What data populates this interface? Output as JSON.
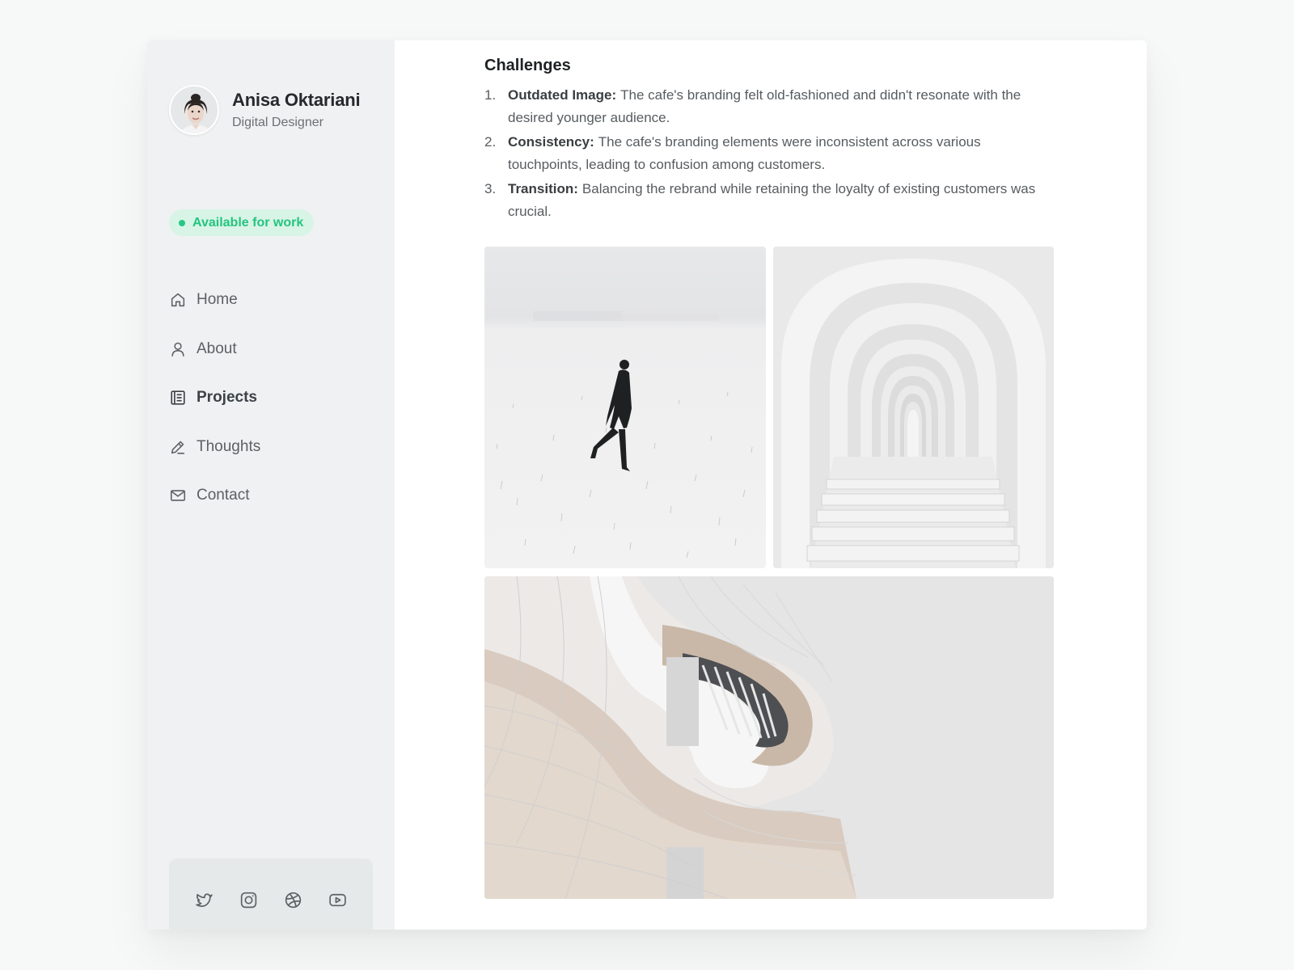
{
  "profile": {
    "name": "Anisa Oktariani",
    "role": "Digital Designer",
    "status": "Available for work",
    "status_color": "#24c47f"
  },
  "nav": [
    {
      "label": "Home",
      "icon": "home-icon"
    },
    {
      "label": "About",
      "icon": "user-icon"
    },
    {
      "label": "Projects",
      "icon": "projects-icon",
      "active": true
    },
    {
      "label": "Thoughts",
      "icon": "pen-icon"
    },
    {
      "label": "Contact",
      "icon": "mail-icon"
    }
  ],
  "social": [
    "twitter-icon",
    "instagram-icon",
    "dribbble-icon",
    "youtube-icon"
  ],
  "content": {
    "section_title": "Challenges",
    "items": [
      {
        "num": "1.",
        "lead": "Outdated Image:",
        "text": "The cafe's branding felt old-fashioned and didn't resonate with the desired younger audience."
      },
      {
        "num": "2.",
        "lead": "Consistency:",
        "text": "The cafe's branding elements were inconsistent across various touchpoints, leading to confusion among customers."
      },
      {
        "num": "3.",
        "lead": "Transition:",
        "text": "Balancing the rebrand while retaining the loyalty of existing customers was crucial."
      }
    ]
  }
}
